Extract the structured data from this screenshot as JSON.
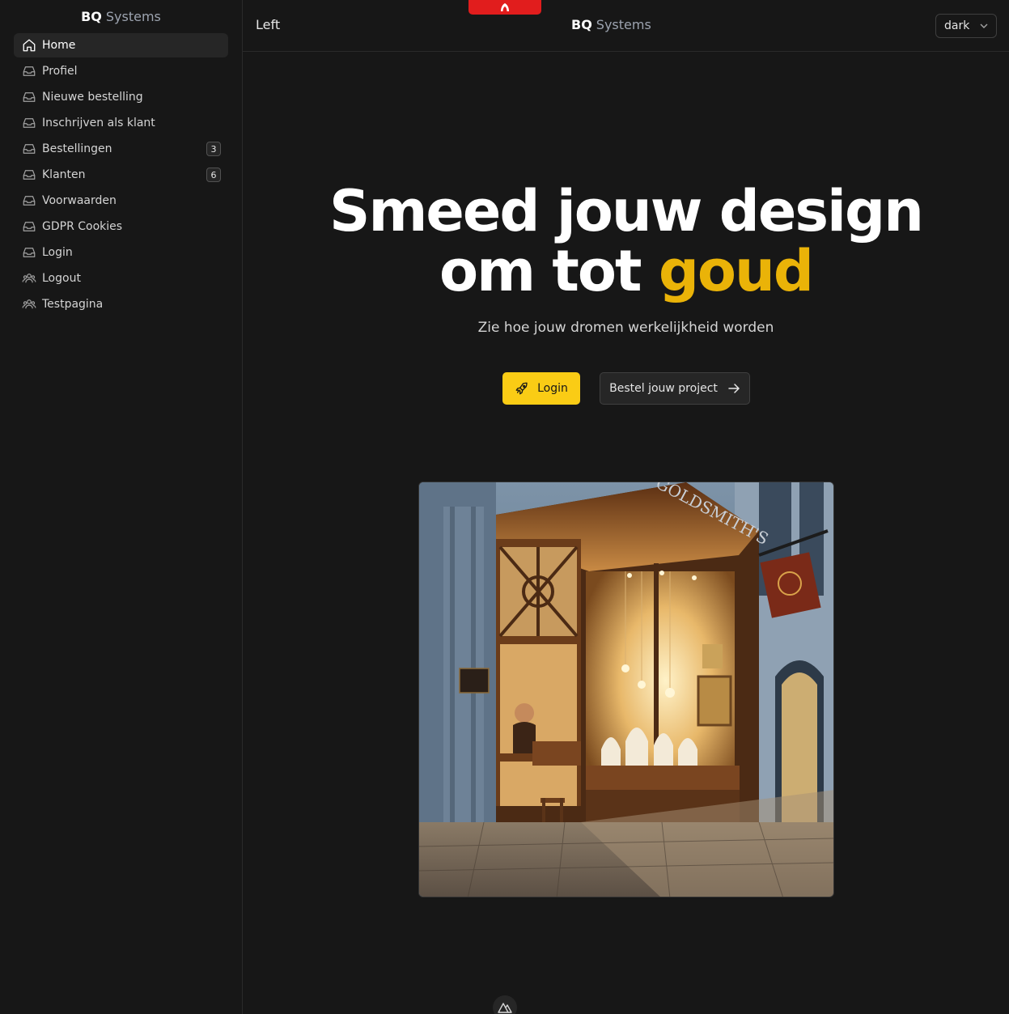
{
  "sidebar": {
    "brand_bold": "BQ",
    "brand_rest": "Systems",
    "items": [
      {
        "label": "Home",
        "icon": "home-icon",
        "active": true
      },
      {
        "label": "Profiel",
        "icon": "inbox-icon"
      },
      {
        "label": "Nieuwe bestelling",
        "icon": "inbox-icon"
      },
      {
        "label": "Inschrijven als klant",
        "icon": "inbox-icon"
      },
      {
        "label": "Bestellingen",
        "icon": "inbox-icon",
        "badge": "3"
      },
      {
        "label": "Klanten",
        "icon": "inbox-icon",
        "badge": "6"
      },
      {
        "label": "Voorwaarden",
        "icon": "inbox-icon"
      },
      {
        "label": "GDPR Cookies",
        "icon": "inbox-icon"
      },
      {
        "label": "Login",
        "icon": "inbox-icon"
      },
      {
        "label": "Logout",
        "icon": "users-icon"
      },
      {
        "label": "Testpagina",
        "icon": "users-icon"
      }
    ]
  },
  "header": {
    "left_label": "Left",
    "brand_bold": "BQ",
    "brand_rest": "Systems",
    "theme_value": "dark"
  },
  "hero": {
    "title_line1": "Smeed jouw design",
    "title_line2_plain": "om tot",
    "title_line2_accent": "goud",
    "subtitle": "Zie hoe jouw dromen werkelijkheid worden",
    "login_label": "Login",
    "order_label": "Bestel jouw project",
    "image_sign_text": "GOLDSMITH'S"
  },
  "colors": {
    "accent": "#eab308",
    "button_yellow": "#facc15",
    "background": "#171717",
    "red_tab": "#e11d1d"
  }
}
